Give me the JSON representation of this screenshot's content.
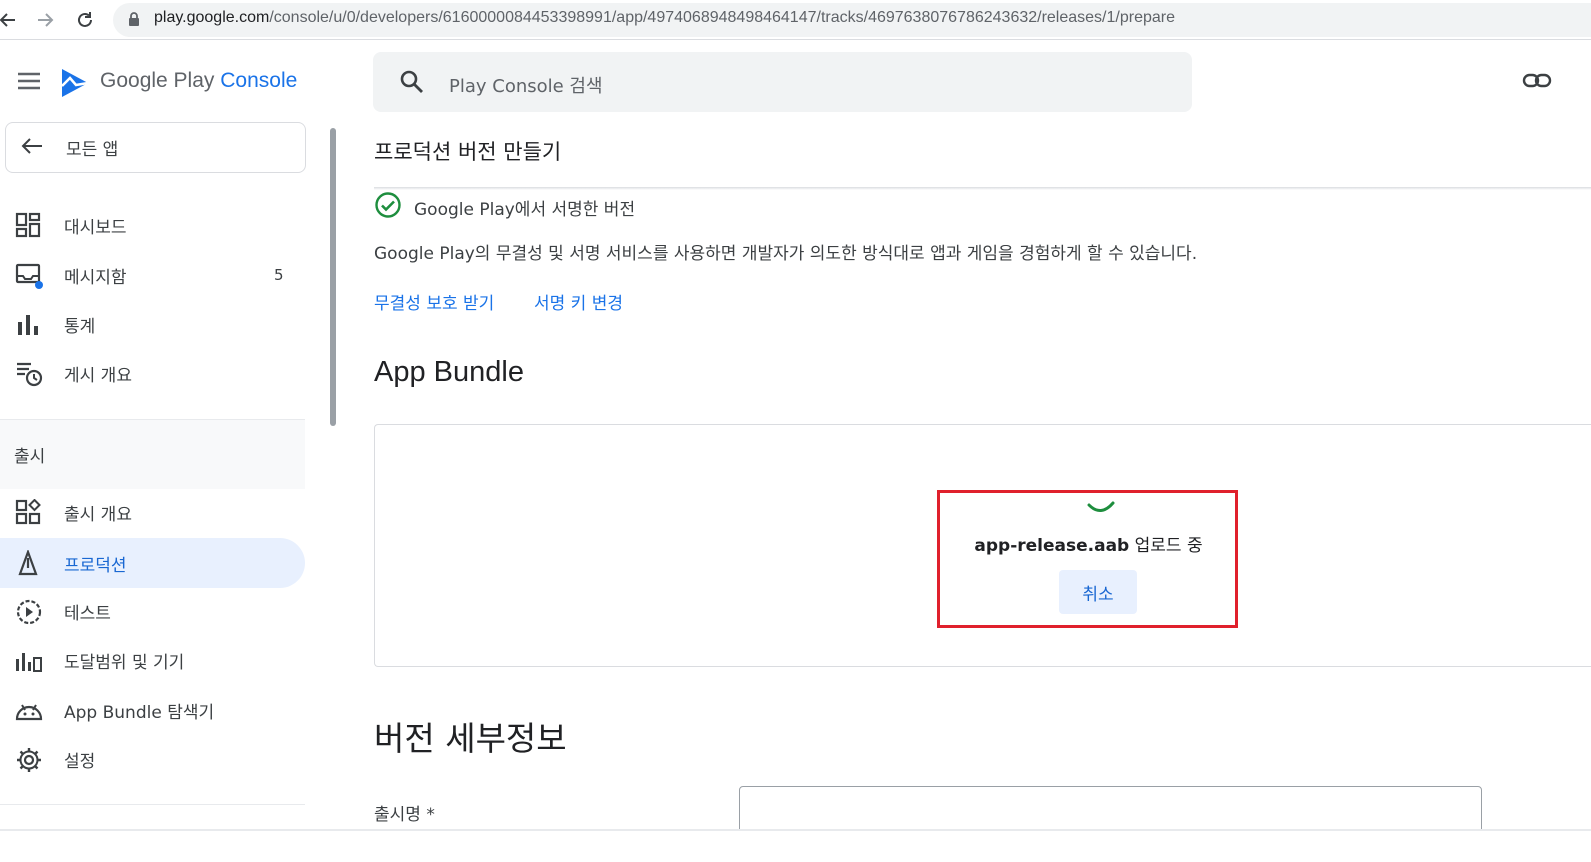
{
  "browser": {
    "url_host": "play.google.com",
    "url_path": "/console/u/0/developers/6160000084453398991/app/4974068948498464147/tracks/4697638076786243632/releases/1/prepare"
  },
  "logo": {
    "prefix": "Google Play ",
    "accent": "Console"
  },
  "sidebar": {
    "all_apps_label": "모든 앱",
    "items": [
      {
        "label": "대시보드",
        "icon": "dashboard-icon"
      },
      {
        "label": "메시지함",
        "icon": "inbox-icon",
        "count": "5"
      },
      {
        "label": "통계",
        "icon": "bar-chart-icon"
      },
      {
        "label": "게시 개요",
        "icon": "publishing-overview-icon"
      }
    ],
    "section": "출시",
    "release_items": [
      {
        "label": "출시 개요",
        "icon": "release-overview-icon"
      },
      {
        "label": "프로덕션",
        "icon": "production-icon",
        "active": true
      },
      {
        "label": "테스트",
        "icon": "testing-icon"
      },
      {
        "label": "도달범위 및 기기",
        "icon": "reach-devices-icon"
      },
      {
        "label": "App Bundle 탐색기",
        "icon": "android-icon"
      },
      {
        "label": "설정",
        "icon": "settings-icon"
      }
    ]
  },
  "search": {
    "placeholder": "Play Console 검색"
  },
  "page": {
    "title": "프로덕션 버전 만들기",
    "signed_text": "Google Play에서 서명한 버전",
    "description": "Google Play의 무결성 및 서명 서비스를 사용하면 개발자가 의도한 방식대로 앱과 게임을 경험하게 할 수 있습니다.",
    "link_integrity": "무결성 보호 받기",
    "link_signing_key": "서명 키 변경",
    "bundle_heading": "App Bundle",
    "upload_filename": "app-release.aab",
    "upload_status": " 업로드 중",
    "cancel_label": "취소",
    "details_heading": "버전 세부정보",
    "release_name_label": "출시명 *"
  },
  "colors": {
    "accent": "#1a73e8",
    "highlight": "#e0202c",
    "success": "#1e8e3e"
  }
}
